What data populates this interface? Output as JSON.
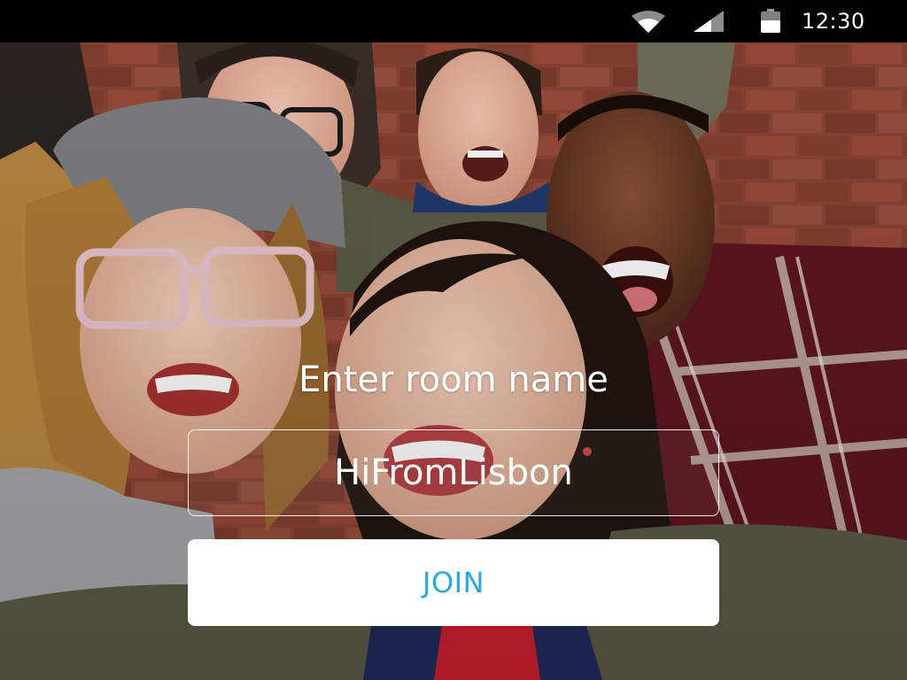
{
  "status_bar": {
    "time": "12:30",
    "icons": [
      "wifi-icon",
      "cellular-signal-icon",
      "battery-icon"
    ]
  },
  "join_form": {
    "label": "Enter room name",
    "room_input_value": "HiFromLisbon",
    "join_button_label": "JOIN"
  },
  "colors": {
    "status_bar_bg": "#000000",
    "join_button_bg": "#ffffff",
    "join_button_text": "#2aa9e8",
    "input_border": "#ffffff",
    "text": "#ffffff"
  }
}
